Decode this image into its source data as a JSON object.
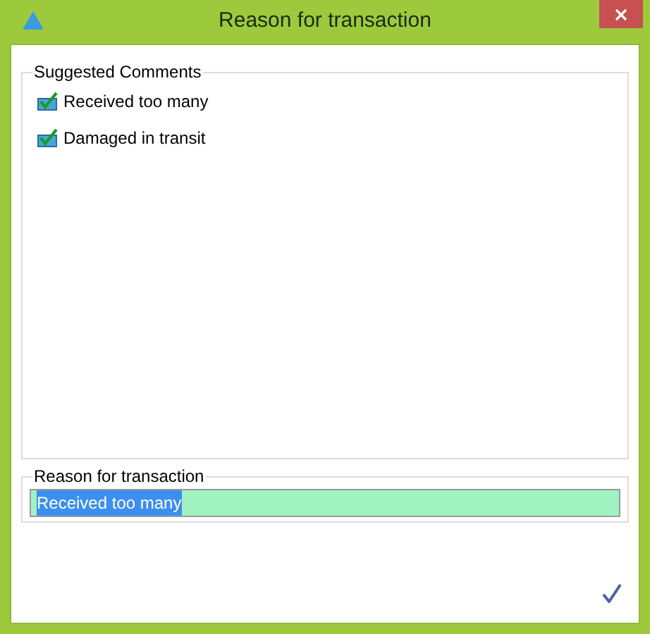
{
  "window": {
    "title": "Reason for transaction"
  },
  "suggested": {
    "title": "Suggested Comments",
    "items": [
      {
        "label": "Received too many"
      },
      {
        "label": "Damaged in transit"
      }
    ]
  },
  "reason": {
    "title": "Reason for transaction",
    "value": "Received too many",
    "value_selected": true
  }
}
